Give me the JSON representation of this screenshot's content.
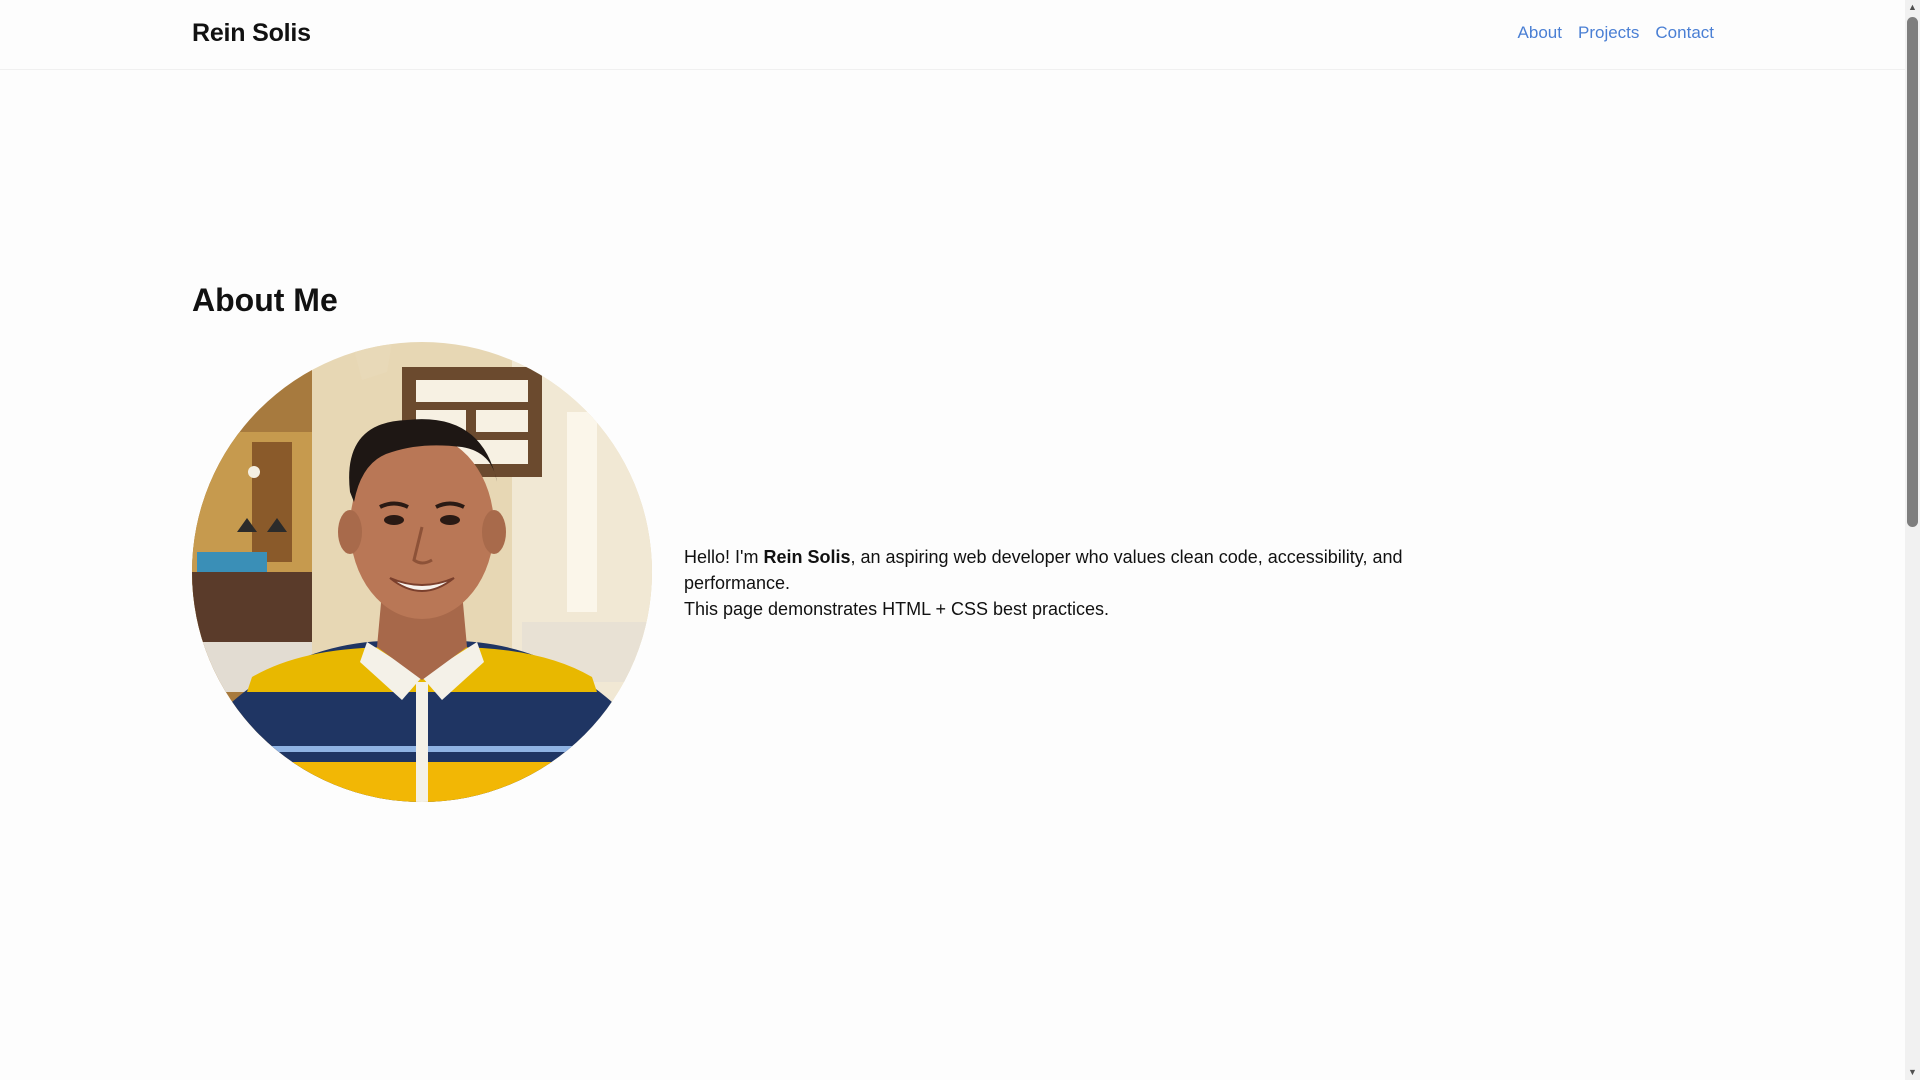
{
  "header": {
    "brand": "Rein Solis",
    "nav": [
      {
        "label": "About"
      },
      {
        "label": "Projects"
      },
      {
        "label": "Contact"
      }
    ]
  },
  "about": {
    "title": "About Me",
    "photo_alt": "Rein Solis",
    "intro_prefix": "Hello! I'm ",
    "intro_name": "Rein Solis",
    "intro_suffix": ", an aspiring web developer who values clean code, accessibility, and performance.",
    "intro_line2": "This page demonstrates HTML + CSS best practices."
  },
  "colors": {
    "link": "#4a7fd4",
    "text": "#111111",
    "background": "#fdfdfd"
  },
  "icons": {
    "scroll_up": "triangle-up-icon",
    "scroll_down": "triangle-down-icon"
  }
}
